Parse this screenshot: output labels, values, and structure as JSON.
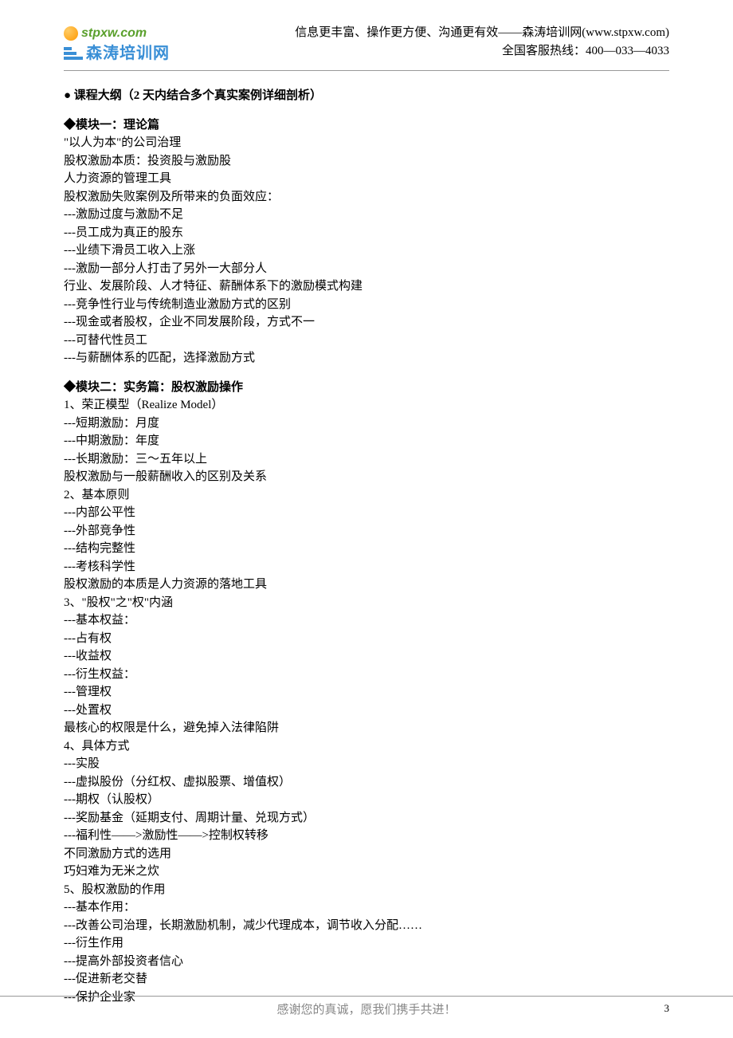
{
  "header": {
    "logo_url": "stpxw.com",
    "logo_cn": "森涛培训网",
    "slogan": "信息更丰富、操作更方便、沟通更有效——森涛培训网(www.stpxw.com)",
    "hotline": "全国客服热线：400—033—4033"
  },
  "title": "● 课程大纲（2 天内结合多个真实案例详细剖析）",
  "module1": {
    "heading": "◆模块一：理论篇",
    "lines": [
      "\"以人为本\"的公司治理",
      "股权激励本质：投资股与激励股",
      "人力资源的管理工具",
      "股权激励失败案例及所带来的负面效应：",
      "---激励过度与激励不足",
      "---员工成为真正的股东",
      "---业绩下滑员工收入上涨",
      "---激励一部分人打击了另外一大部分人",
      "行业、发展阶段、人才特征、薪酬体系下的激励模式构建",
      "---竞争性行业与传统制造业激励方式的区别",
      "---现金或者股权，企业不同发展阶段，方式不一",
      "---可替代性员工",
      "---与薪酬体系的匹配，选择激励方式"
    ]
  },
  "module2": {
    "heading": "◆模块二：实务篇：股权激励操作",
    "lines": [
      "1、荣正模型（Realize Model）",
      "---短期激励：月度",
      "---中期激励：年度",
      "---长期激励：三～五年以上",
      "股权激励与一般薪酬收入的区别及关系",
      "2、基本原则",
      "---内部公平性",
      "---外部竞争性",
      "---结构完整性",
      "---考核科学性",
      "股权激励的本质是人力资源的落地工具",
      "3、\"股权\"之\"权\"内涵",
      "---基本权益：",
      "---占有权",
      "---收益权",
      "---衍生权益：",
      "---管理权",
      "---处置权",
      "最核心的权限是什么，避免掉入法律陷阱",
      "4、具体方式",
      "---实股",
      "---虚拟股份（分红权、虚拟股票、增值权）",
      "---期权（认股权）",
      "---奖励基金（延期支付、周期计量、兑现方式）",
      "---福利性——>激励性——>控制权转移",
      "不同激励方式的选用",
      "巧妇难为无米之炊",
      "5、股权激励的作用",
      "---基本作用：",
      "---改善公司治理，长期激励机制，减少代理成本，调节收入分配……",
      "---衍生作用",
      "---提高外部投资者信心",
      "---促进新老交替",
      "---保护企业家"
    ]
  },
  "footer": {
    "text": "感谢您的真诚，愿我们携手共进！",
    "page": "3"
  }
}
